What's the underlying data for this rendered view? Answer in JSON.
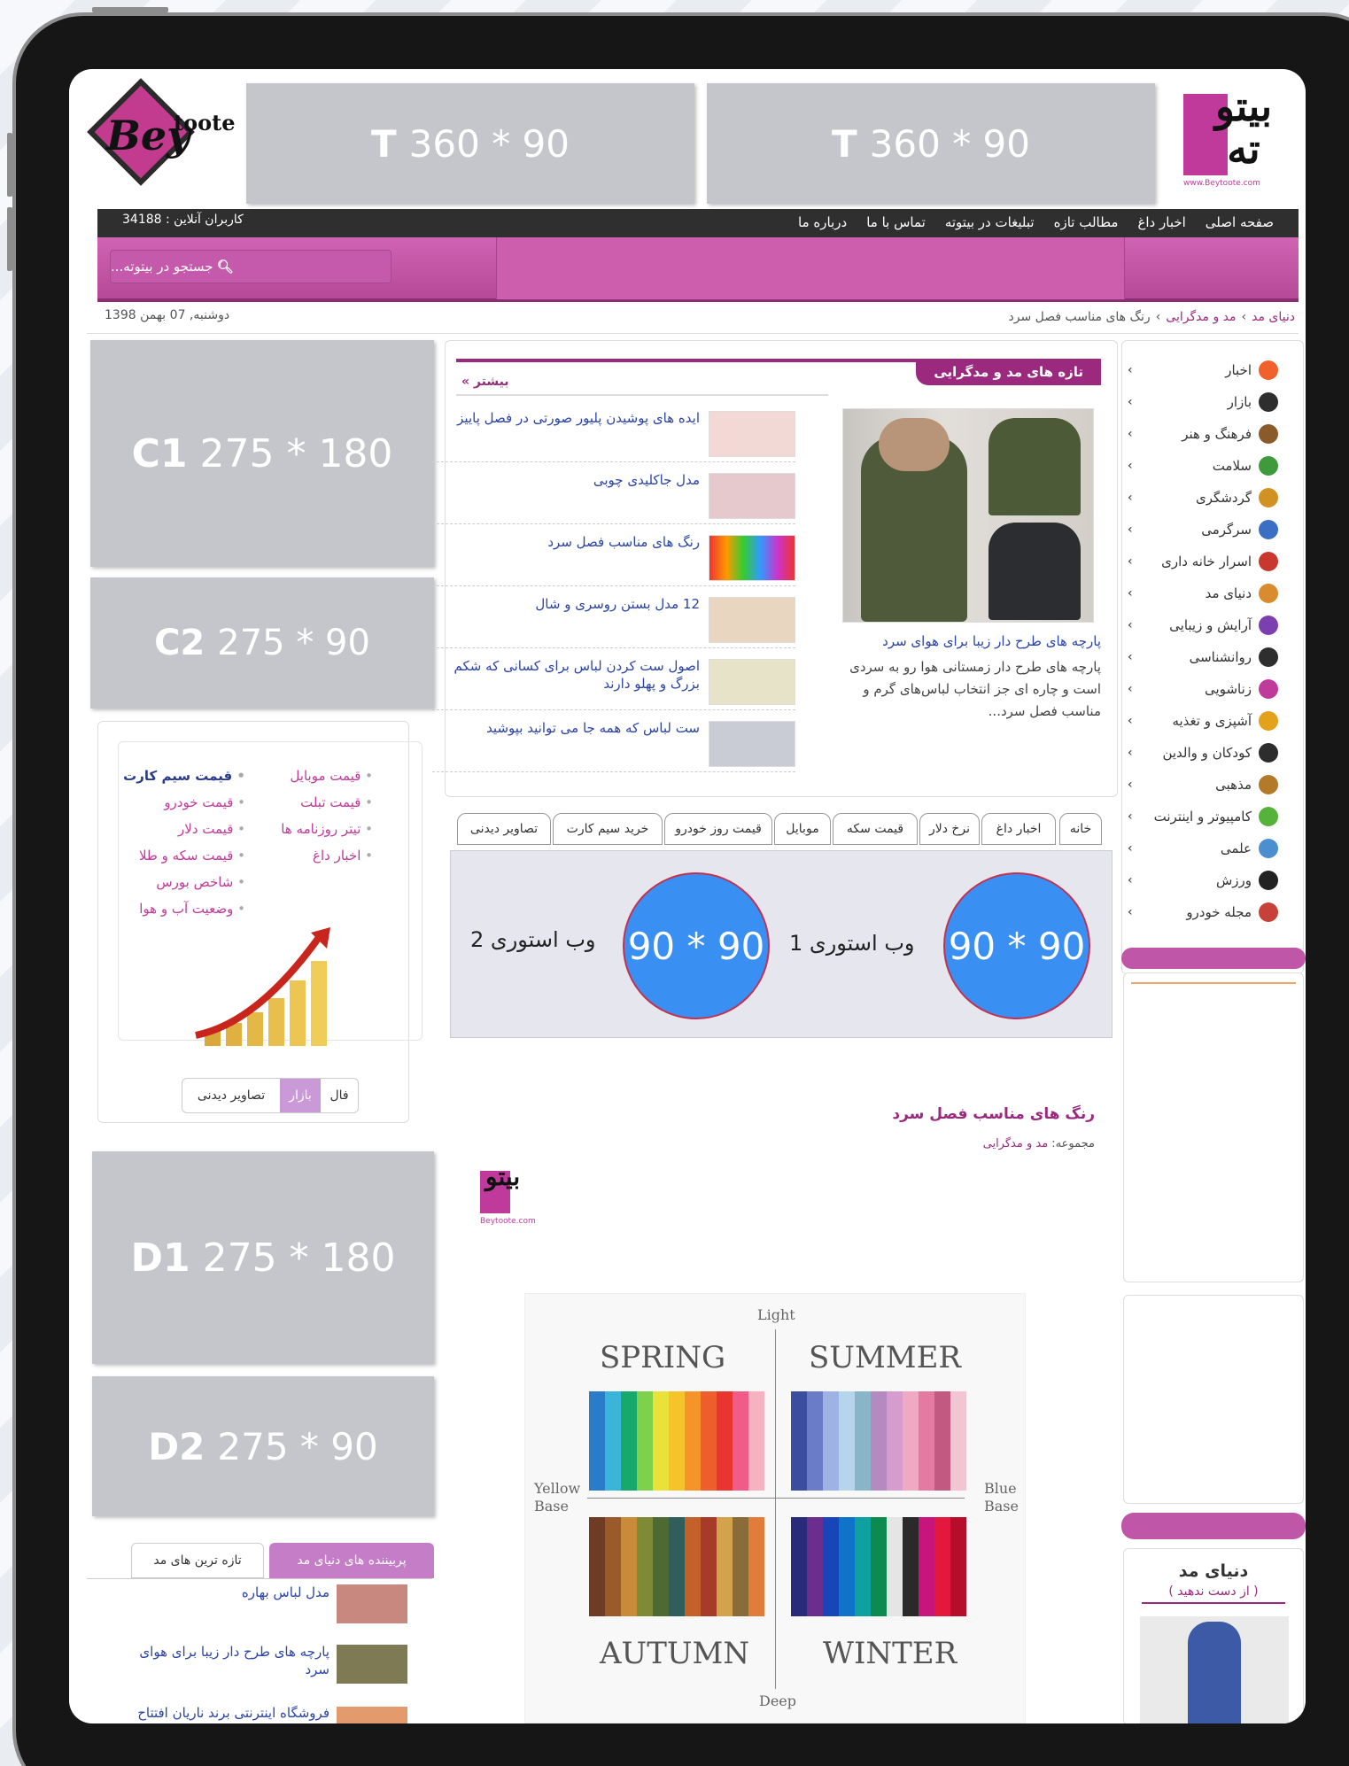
{
  "header": {
    "logo_left_alt": "Beytoote",
    "logo_left_text_1": "toote",
    "logo_left_text_2": "Bey",
    "logo_right_url": "www.Beytoote.com",
    "banner_1": {
      "letter": "T",
      "size": "360 * 90"
    },
    "banner_2": {
      "letter": "T",
      "size": "360 * 90"
    }
  },
  "topbar": {
    "nav": [
      "صفحه اصلی",
      "اخبار داغ",
      "مطالب تازه",
      "تبلیغات در بیتوته",
      "تماس با ما",
      "درباره ما"
    ],
    "online_users": "کاربران آنلاین : 34188"
  },
  "search": {
    "placeholder": "جستجو در بیتوته..."
  },
  "breadcrumb": {
    "home": "دنیای مد",
    "section": "مد و مدگرایی",
    "current": "رنگ های مناسب فصل سرد"
  },
  "date": "دوشنبه, 07 بهمن 1398",
  "sidebar_right": {
    "categories": [
      "اخبار",
      "بازار",
      "فرهنگ و هنر",
      "سلامت",
      "گردشگری",
      "سرگرمی",
      "اسرار خانه داری",
      "دنیای مد",
      "آرایش و زیبایی",
      "روانشناسی",
      "زناشویی",
      "آشپزی و تغذیه",
      "کودکان و والدین",
      "مذهبی",
      "کامپیوتر و اینترنت",
      "علمی",
      "ورزش",
      "مجله خودرو"
    ],
    "icon_colors": [
      "#f0612c",
      "#2e2e2e",
      "#8a5a2b",
      "#3e9a3b",
      "#d19223",
      "#3b6fc4",
      "#c9382e",
      "#d98b2d",
      "#7b3fb0",
      "#2e2e2e",
      "#c03a9c",
      "#e4a21c",
      "#2d2d2d",
      "#b37a2a",
      "#55b33b",
      "#4b8fd0",
      "#222222",
      "#c8403a"
    ],
    "promo_title": "دنیای مد",
    "promo_subtitle": "( از دست ندهید )"
  },
  "fashion_box": {
    "title": "تازه های مد و مدگرایی",
    "more": "بیشتر »",
    "featured": {
      "title": "پارچه های طرح دار زیبا برای هوای سرد",
      "summary": "پارچه های طرح دار زمستانی هوا رو به سردی است و چاره ای جز انتخاب لباس‌های گرم و مناسب فصل سرد..."
    },
    "items": [
      "ایده های پوشیدن پلیور صورتی در فصل پاییز",
      "مدل جاکلیدی چوبی",
      "رنگ های مناسب فصل سرد",
      "12 مدل بستن روسری و شال",
      "اصول ست کردن لباس برای کسانی که شکم بزرگ و پهلو دارند",
      "ست لباس که همه جا می توانید بپوشید"
    ]
  },
  "tabs": [
    "خانه",
    "اخبار داغ",
    "نرخ دلار",
    "قیمت سکه",
    "موبایل",
    "قیمت روز خودرو",
    "خرید سیم کارت",
    "تصاویر دیدنی"
  ],
  "webstory": [
    {
      "size": "90 * 90",
      "label": "وب استوری 1"
    },
    {
      "size": "90 * 90",
      "label": "وب استوری 2"
    }
  ],
  "article": {
    "title": "رنگ های مناسب فصل سرد",
    "category_label": "مجموعه:",
    "category": "مد و مدگرایی",
    "logo_caption": "Beytoote.com",
    "chart_labels": {
      "light": "Light",
      "deep": "Deep",
      "yellow": "Yellow",
      "yellow_base": "Base",
      "blue": "Blue",
      "blue_base": "Base",
      "spring": "SPRING",
      "summer": "SUMMER",
      "autumn": "AUTUMN",
      "winter": "WINTER"
    },
    "palettes": {
      "spring": [
        "#2a7bc8",
        "#3ab4d8",
        "#17a86c",
        "#7ed14b",
        "#e9e23a",
        "#f5c32a",
        "#f49429",
        "#ee5d2c",
        "#e8352f",
        "#f15b8a",
        "#f7b2c1"
      ],
      "summer": [
        "#3a4e9e",
        "#6b7cc6",
        "#9fb2e4",
        "#b6d4ea",
        "#8ab5c9",
        "#b48bc0",
        "#d59ccd",
        "#f0a9c2",
        "#e47aa1",
        "#c15981",
        "#f1c6d2"
      ],
      "autumn": [
        "#6e3b25",
        "#9a5a2a",
        "#c98a3a",
        "#7e8a35",
        "#4c6a31",
        "#2f5e5b",
        "#c4612b",
        "#a83a2a",
        "#d2a34b",
        "#8a6b3a",
        "#e27c3b"
      ],
      "winter": [
        "#2a2a7a",
        "#6b2d8e",
        "#1846b8",
        "#0f73c9",
        "#0fa0a0",
        "#0d8a4e",
        "#e5e5e5",
        "#2a2a2a",
        "#c8157d",
        "#e4173d",
        "#b40e2a"
      ]
    }
  },
  "ads_left": [
    {
      "letter": "C1",
      "size": "275 * 180"
    },
    {
      "letter": "C2",
      "size": "275 * 90"
    },
    {
      "letter": "D1",
      "size": "275 * 180"
    },
    {
      "letter": "D2",
      "size": "275 * 90"
    }
  ],
  "market": {
    "col_right": [
      "قیمت موبایل",
      "قیمت تبلت",
      "تیتر روزنامه ها",
      "اخبار داغ"
    ],
    "col_left": [
      "قیمت سیم کارت",
      "قیمت خودرو",
      "قیمت دلار",
      "قیمت سکه و طلا",
      "شاخص بورس",
      "وضعیت آب و هوا"
    ],
    "tabs": [
      "فال",
      "بازار",
      "تصاویر دیدنی"
    ]
  },
  "latest": {
    "tabs": [
      "پربیننده های دنیای مد",
      "تازه ترین های مد"
    ],
    "items": [
      "مدل لباس بهاره",
      "پارچه های طرح دار زیبا برای هوای سرد",
      "فروشگاه اینترنتی برند ناریان افتتاح"
    ]
  }
}
